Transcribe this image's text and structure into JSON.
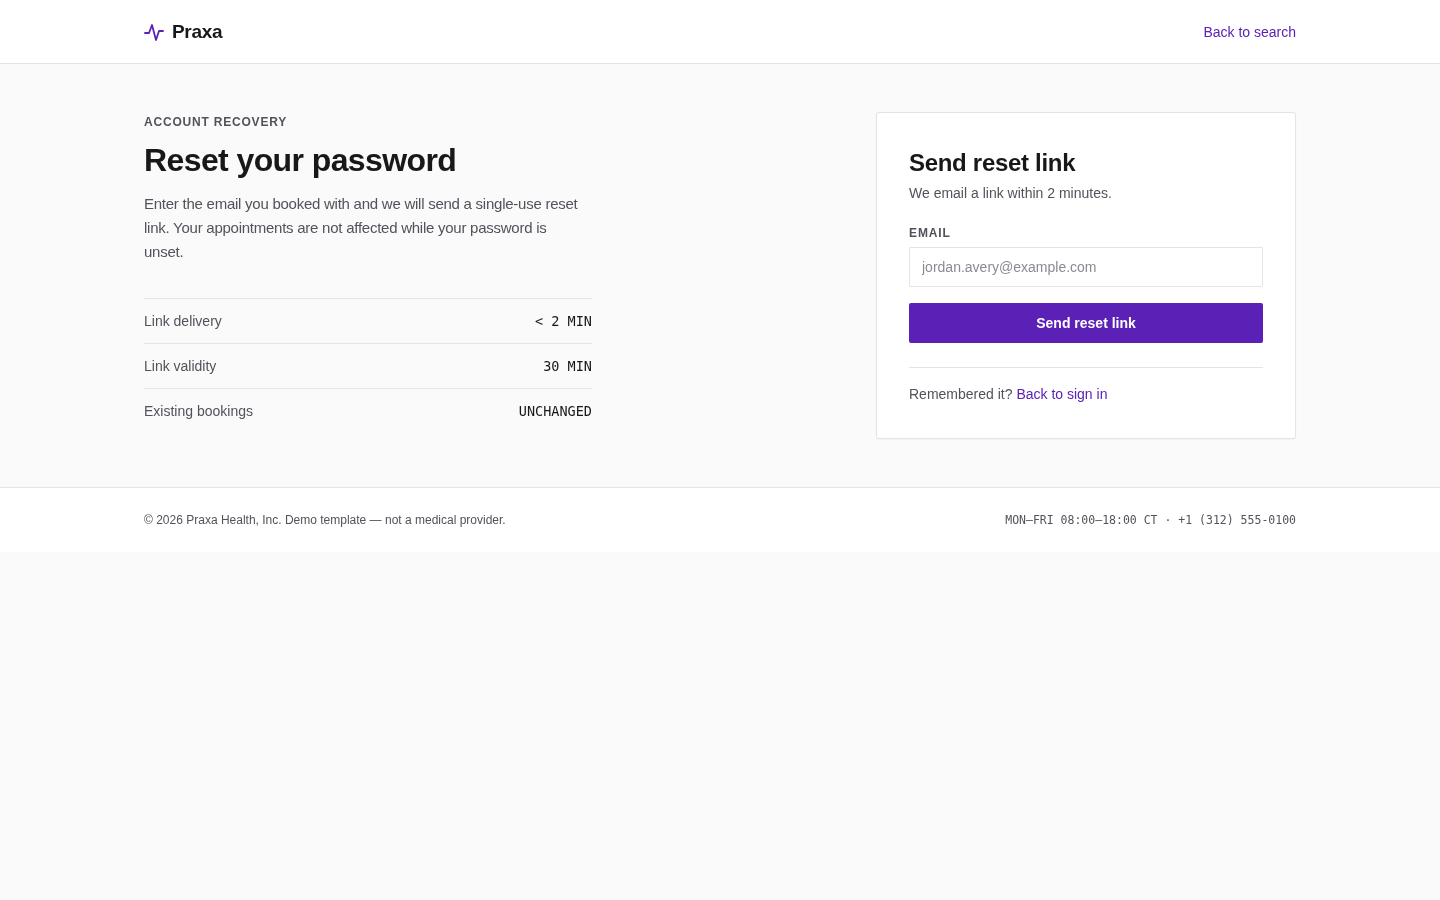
{
  "header": {
    "brand": "Praxa",
    "back_link": "Back to search"
  },
  "intro": {
    "eyebrow": "ACCOUNT RECOVERY",
    "title": "Reset your password",
    "description": "Enter the email you booked with and we will send a single-use reset link. Your appointments are not affected while your password is unset."
  },
  "facts": [
    {
      "label": "Link delivery",
      "value": "< 2 MIN"
    },
    {
      "label": "Link validity",
      "value": "30 MIN"
    },
    {
      "label": "Existing bookings",
      "value": "UNCHANGED"
    }
  ],
  "form_card": {
    "title": "Send reset link",
    "subtitle": "We email a link within 2 minutes.",
    "email_field": {
      "label": "EMAIL",
      "placeholder": "jordan.avery@example.com"
    },
    "submit_button": "Send reset link",
    "prompt_text": "Remembered it?",
    "prompt_link": "Back to sign in"
  },
  "footer": {
    "copyright": "© 2026 Praxa Health, Inc. Demo template — not a medical provider.",
    "contact": "MON–FRI 08:00–18:00 CT · +1 (312) 555-0100"
  }
}
